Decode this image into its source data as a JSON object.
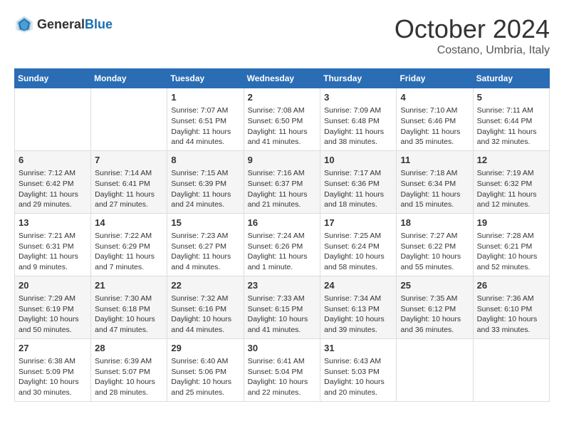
{
  "header": {
    "logo_general": "General",
    "logo_blue": "Blue",
    "month_title": "October 2024",
    "location": "Costano, Umbria, Italy"
  },
  "days_of_week": [
    "Sunday",
    "Monday",
    "Tuesday",
    "Wednesday",
    "Thursday",
    "Friday",
    "Saturday"
  ],
  "weeks": [
    [
      {
        "day": "",
        "sunrise": "",
        "sunset": "",
        "daylight": ""
      },
      {
        "day": "",
        "sunrise": "",
        "sunset": "",
        "daylight": ""
      },
      {
        "day": "1",
        "sunrise": "Sunrise: 7:07 AM",
        "sunset": "Sunset: 6:51 PM",
        "daylight": "Daylight: 11 hours and 44 minutes."
      },
      {
        "day": "2",
        "sunrise": "Sunrise: 7:08 AM",
        "sunset": "Sunset: 6:50 PM",
        "daylight": "Daylight: 11 hours and 41 minutes."
      },
      {
        "day": "3",
        "sunrise": "Sunrise: 7:09 AM",
        "sunset": "Sunset: 6:48 PM",
        "daylight": "Daylight: 11 hours and 38 minutes."
      },
      {
        "day": "4",
        "sunrise": "Sunrise: 7:10 AM",
        "sunset": "Sunset: 6:46 PM",
        "daylight": "Daylight: 11 hours and 35 minutes."
      },
      {
        "day": "5",
        "sunrise": "Sunrise: 7:11 AM",
        "sunset": "Sunset: 6:44 PM",
        "daylight": "Daylight: 11 hours and 32 minutes."
      }
    ],
    [
      {
        "day": "6",
        "sunrise": "Sunrise: 7:12 AM",
        "sunset": "Sunset: 6:42 PM",
        "daylight": "Daylight: 11 hours and 29 minutes."
      },
      {
        "day": "7",
        "sunrise": "Sunrise: 7:14 AM",
        "sunset": "Sunset: 6:41 PM",
        "daylight": "Daylight: 11 hours and 27 minutes."
      },
      {
        "day": "8",
        "sunrise": "Sunrise: 7:15 AM",
        "sunset": "Sunset: 6:39 PM",
        "daylight": "Daylight: 11 hours and 24 minutes."
      },
      {
        "day": "9",
        "sunrise": "Sunrise: 7:16 AM",
        "sunset": "Sunset: 6:37 PM",
        "daylight": "Daylight: 11 hours and 21 minutes."
      },
      {
        "day": "10",
        "sunrise": "Sunrise: 7:17 AM",
        "sunset": "Sunset: 6:36 PM",
        "daylight": "Daylight: 11 hours and 18 minutes."
      },
      {
        "day": "11",
        "sunrise": "Sunrise: 7:18 AM",
        "sunset": "Sunset: 6:34 PM",
        "daylight": "Daylight: 11 hours and 15 minutes."
      },
      {
        "day": "12",
        "sunrise": "Sunrise: 7:19 AM",
        "sunset": "Sunset: 6:32 PM",
        "daylight": "Daylight: 11 hours and 12 minutes."
      }
    ],
    [
      {
        "day": "13",
        "sunrise": "Sunrise: 7:21 AM",
        "sunset": "Sunset: 6:31 PM",
        "daylight": "Daylight: 11 hours and 9 minutes."
      },
      {
        "day": "14",
        "sunrise": "Sunrise: 7:22 AM",
        "sunset": "Sunset: 6:29 PM",
        "daylight": "Daylight: 11 hours and 7 minutes."
      },
      {
        "day": "15",
        "sunrise": "Sunrise: 7:23 AM",
        "sunset": "Sunset: 6:27 PM",
        "daylight": "Daylight: 11 hours and 4 minutes."
      },
      {
        "day": "16",
        "sunrise": "Sunrise: 7:24 AM",
        "sunset": "Sunset: 6:26 PM",
        "daylight": "Daylight: 11 hours and 1 minute."
      },
      {
        "day": "17",
        "sunrise": "Sunrise: 7:25 AM",
        "sunset": "Sunset: 6:24 PM",
        "daylight": "Daylight: 10 hours and 58 minutes."
      },
      {
        "day": "18",
        "sunrise": "Sunrise: 7:27 AM",
        "sunset": "Sunset: 6:22 PM",
        "daylight": "Daylight: 10 hours and 55 minutes."
      },
      {
        "day": "19",
        "sunrise": "Sunrise: 7:28 AM",
        "sunset": "Sunset: 6:21 PM",
        "daylight": "Daylight: 10 hours and 52 minutes."
      }
    ],
    [
      {
        "day": "20",
        "sunrise": "Sunrise: 7:29 AM",
        "sunset": "Sunset: 6:19 PM",
        "daylight": "Daylight: 10 hours and 50 minutes."
      },
      {
        "day": "21",
        "sunrise": "Sunrise: 7:30 AM",
        "sunset": "Sunset: 6:18 PM",
        "daylight": "Daylight: 10 hours and 47 minutes."
      },
      {
        "day": "22",
        "sunrise": "Sunrise: 7:32 AM",
        "sunset": "Sunset: 6:16 PM",
        "daylight": "Daylight: 10 hours and 44 minutes."
      },
      {
        "day": "23",
        "sunrise": "Sunrise: 7:33 AM",
        "sunset": "Sunset: 6:15 PM",
        "daylight": "Daylight: 10 hours and 41 minutes."
      },
      {
        "day": "24",
        "sunrise": "Sunrise: 7:34 AM",
        "sunset": "Sunset: 6:13 PM",
        "daylight": "Daylight: 10 hours and 39 minutes."
      },
      {
        "day": "25",
        "sunrise": "Sunrise: 7:35 AM",
        "sunset": "Sunset: 6:12 PM",
        "daylight": "Daylight: 10 hours and 36 minutes."
      },
      {
        "day": "26",
        "sunrise": "Sunrise: 7:36 AM",
        "sunset": "Sunset: 6:10 PM",
        "daylight": "Daylight: 10 hours and 33 minutes."
      }
    ],
    [
      {
        "day": "27",
        "sunrise": "Sunrise: 6:38 AM",
        "sunset": "Sunset: 5:09 PM",
        "daylight": "Daylight: 10 hours and 30 minutes."
      },
      {
        "day": "28",
        "sunrise": "Sunrise: 6:39 AM",
        "sunset": "Sunset: 5:07 PM",
        "daylight": "Daylight: 10 hours and 28 minutes."
      },
      {
        "day": "29",
        "sunrise": "Sunrise: 6:40 AM",
        "sunset": "Sunset: 5:06 PM",
        "daylight": "Daylight: 10 hours and 25 minutes."
      },
      {
        "day": "30",
        "sunrise": "Sunrise: 6:41 AM",
        "sunset": "Sunset: 5:04 PM",
        "daylight": "Daylight: 10 hours and 22 minutes."
      },
      {
        "day": "31",
        "sunrise": "Sunrise: 6:43 AM",
        "sunset": "Sunset: 5:03 PM",
        "daylight": "Daylight: 10 hours and 20 minutes."
      },
      {
        "day": "",
        "sunrise": "",
        "sunset": "",
        "daylight": ""
      },
      {
        "day": "",
        "sunrise": "",
        "sunset": "",
        "daylight": ""
      }
    ]
  ]
}
